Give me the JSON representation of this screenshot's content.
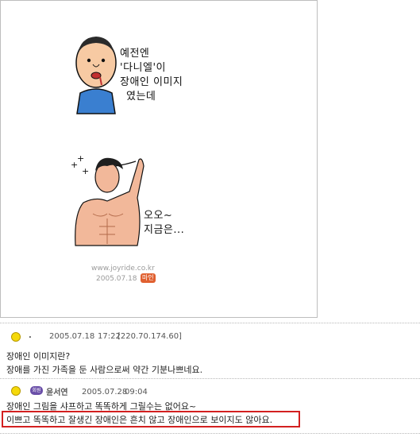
{
  "comic": {
    "bubble1_lines": [
      "예전엔",
      "'다니엘'이",
      "장애인 이미지",
      "였는데"
    ],
    "bubble2_lines": [
      "오오~",
      "지금은..."
    ],
    "credit_site": "www.joyride.co.kr",
    "credit_date": "2005.07.18",
    "credit_stamp": "마인"
  },
  "comments": [
    {
      "author": ".",
      "date": "2005.07.18",
      "time": "17:22",
      "ip": "[220.70.174.60]",
      "lines": [
        "장애인 이미지란?",
        "장애를 가진 가족을 둔 사람으로써 약간 기분나쁘네요."
      ]
    },
    {
      "author": "윤서연",
      "date": "2005.07.28",
      "time": "09:04",
      "lines": [
        "장애인 그림을 샤프하고 똑똑하게 그릴수는 없어요~",
        "이쁘고 똑똑하고 잘생긴 장애인은 흔치 않고 장애인으로 보이지도 않아요."
      ]
    }
  ],
  "colors": {
    "highlight": "#d32020",
    "smiley": "#f5d90a",
    "stamp": "#e06030"
  }
}
